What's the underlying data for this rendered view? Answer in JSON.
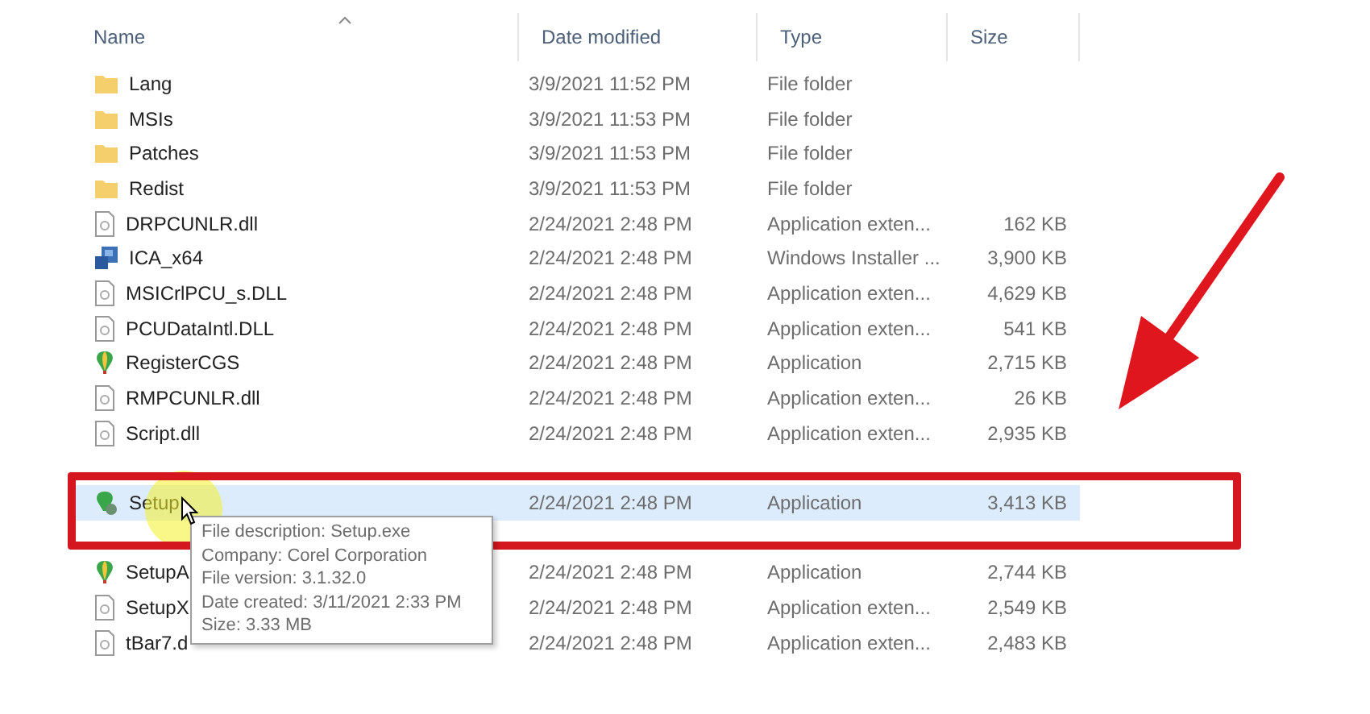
{
  "columns": [
    {
      "label": "Name",
      "sorted": true
    },
    {
      "label": "Date modified",
      "sorted": false
    },
    {
      "label": "Type",
      "sorted": false
    },
    {
      "label": "Size",
      "sorted": false
    }
  ],
  "rows": [
    {
      "kind": "folder",
      "name": "Lang",
      "date": "3/9/2021 11:52 PM",
      "type": "File folder",
      "selected": false
    },
    {
      "kind": "folder",
      "name": "MSIs",
      "date": "3/9/2021 11:53 PM",
      "type": "File folder",
      "selected": false
    },
    {
      "kind": "folder",
      "name": "Patches",
      "date": "3/9/2021 11:53 PM",
      "type": "File folder",
      "selected": false
    },
    {
      "kind": "folder",
      "name": "Redist",
      "date": "3/9/2021 11:53 PM",
      "type": "File folder",
      "selected": false
    },
    {
      "kind": "dll",
      "name": "DRPCUNLR.dll",
      "date": "2/24/2021 2:48 PM",
      "type": "Application exten...",
      "size": "162 KB",
      "selected": false
    },
    {
      "kind": "installer",
      "name": "ICA_x64",
      "date": "2/24/2021 2:48 PM",
      "type": "Windows Installer ...",
      "size": "3,900 KB",
      "selected": false
    },
    {
      "kind": "dll",
      "name": "MSICrlPCU_s.DLL",
      "date": "2/24/2021 2:48 PM",
      "type": "Application exten...",
      "size": "4,629 KB",
      "selected": false
    },
    {
      "kind": "dll",
      "name": "PCUDataIntl.DLL",
      "date": "2/24/2021 2:48 PM",
      "type": "Application exten...",
      "size": "541 KB",
      "selected": false
    },
    {
      "kind": "app",
      "name": "RegisterCGS",
      "date": "2/24/2021 2:48 PM",
      "type": "Application",
      "size": "2,715 KB",
      "selected": false
    },
    {
      "kind": "dll",
      "name": "RMPCUNLR.dll",
      "date": "2/24/2021 2:48 PM",
      "type": "Application exten...",
      "size": "26 KB",
      "selected": false
    },
    {
      "kind": "dll",
      "name": "Script.dll",
      "date": "2/24/2021 2:48 PM",
      "type": "Application exten...",
      "size": "2,935 KB",
      "selected": false
    },
    {
      "kind": "covered"
    },
    {
      "kind": "setup",
      "name": "Setup",
      "date": "2/24/2021 2:48 PM",
      "type": "Application",
      "size": "3,413 KB",
      "selected": true
    },
    {
      "kind": "covered"
    },
    {
      "kind": "app",
      "name": "SetupA",
      "date": "2/24/2021 2:48 PM",
      "type": "Application",
      "size": "2,744 KB",
      "selected": false
    },
    {
      "kind": "dll",
      "name": "SetupX",
      "date": "2/24/2021 2:48 PM",
      "type": "Application exten...",
      "size": "2,549 KB",
      "selected": false
    },
    {
      "kind": "dll",
      "name": "tBar7.d",
      "date": "2/24/2021 2:48 PM",
      "type": "Application exten...",
      "size": "2,483 KB",
      "selected": false
    }
  ],
  "tooltip": [
    "File description: Setup.exe",
    "Company: Corel Corporation",
    "File version: 3.1.32.0",
    "Date created: 3/11/2021 2:33 PM",
    "Size: 3.33 MB"
  ]
}
